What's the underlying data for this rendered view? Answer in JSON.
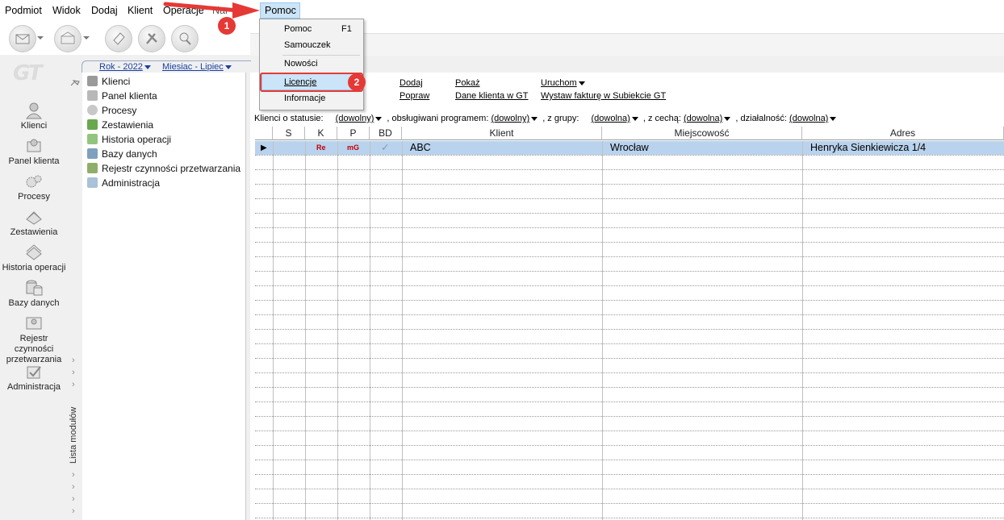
{
  "menubar": {
    "items": [
      "Podmiot",
      "Widok",
      "Dodaj",
      "Klient",
      "Operacje",
      "Nar"
    ],
    "active": "Pomoc"
  },
  "help_menu": {
    "items": [
      {
        "label": "Pomoc",
        "shortcut": "F1"
      },
      {
        "label": "Samouczek"
      },
      {
        "label": "Nowości"
      },
      {
        "label": "Licencje"
      },
      {
        "label": "Informacje"
      }
    ],
    "highlighted": "Licencje"
  },
  "annotations": {
    "step1": "1",
    "step2": "2",
    "accent": "#e53935"
  },
  "period": {
    "year": "Rok - 2022",
    "month": "Miesiac - Lipiec"
  },
  "left_nav": {
    "items": [
      "Klienci",
      "Panel klienta",
      "Procesy",
      "Zestawienia",
      "Historia operacji",
      "Bazy danych",
      "Rejestr czynności przetwarzania",
      "Administracja"
    ]
  },
  "modules": {
    "panel_label": "Lista modułów",
    "items": [
      "Klienci",
      "Panel klienta",
      "Procesy",
      "Zestawienia",
      "Historia operacji",
      "Bazy danych",
      "Rejestr czynności przetwarzania",
      "Administracja"
    ]
  },
  "actions": {
    "dodaj": "Dodaj",
    "popraw": "Popraw",
    "pokaz": "Pokaż",
    "dane_klienta": "Dane klienta w GT",
    "uruchom": "Uruchom",
    "wystaw": "Wystaw fakturę w Subiekcie GT"
  },
  "filter": {
    "status_label": "Klienci o statusie:",
    "status_value": "(dowolny)",
    "program_label": ", obsługiwani programem:",
    "program_value": "(dowolny)",
    "group_label": ", z grupy:",
    "group_value": "(dowolna)",
    "feature_label": ", z cechą:",
    "feature_value": "(dowolna)",
    "activity_label": ", działalność:",
    "activity_value": "(dowolna)"
  },
  "grid": {
    "columns": [
      "S",
      "K",
      "P",
      "BD",
      "Klient",
      "Miejscowość",
      "Adres"
    ],
    "rows": [
      {
        "S": "",
        "K": "Re",
        "P": "mG",
        "BD": "✓",
        "Klient": "ABC",
        "Miejscowosc": "Wrocław",
        "Adres": "Henryka Sienkiewicza 1/4"
      }
    ]
  },
  "app_logo": "GT"
}
